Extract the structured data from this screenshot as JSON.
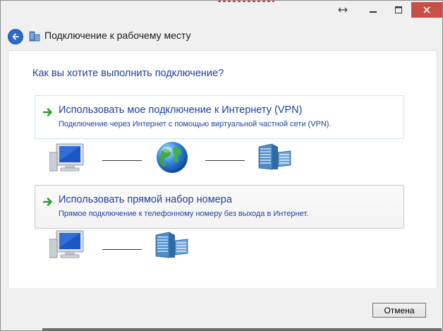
{
  "window": {
    "title": "Подключение к рабочему месту",
    "controls": {
      "resize_icon": "resize-arrows-icon",
      "minimize_icon": "minimize-icon",
      "maximize_icon": "maximize-icon",
      "close_icon": "close-icon"
    }
  },
  "nav": {
    "back_icon": "back-arrow-icon",
    "title_icon": "workplace-network-icon",
    "title": "Подключение к рабочему месту"
  },
  "content": {
    "heading": "Как вы хотите выполнить подключение?",
    "options": [
      {
        "title": "Использовать мое подключение к Интернету (VPN)",
        "description": "Подключение через Интернет с помощью виртуальной частной сети (VPN).",
        "icon": "green-arrow-icon",
        "diagram": [
          "computer-icon",
          "globe-icon",
          "server-icon"
        ]
      },
      {
        "title": "Использовать прямой набор номера",
        "description": "Прямое подключение к телефонному номеру без выхода в Интернет.",
        "icon": "green-arrow-icon",
        "diagram": [
          "computer-icon",
          "server-icon"
        ]
      }
    ]
  },
  "footer": {
    "cancel_label": "Отмена"
  },
  "colors": {
    "link_blue": "#1e3fa0",
    "window_bg": "#f0f0f0",
    "accent_green": "#2e9e2e"
  }
}
